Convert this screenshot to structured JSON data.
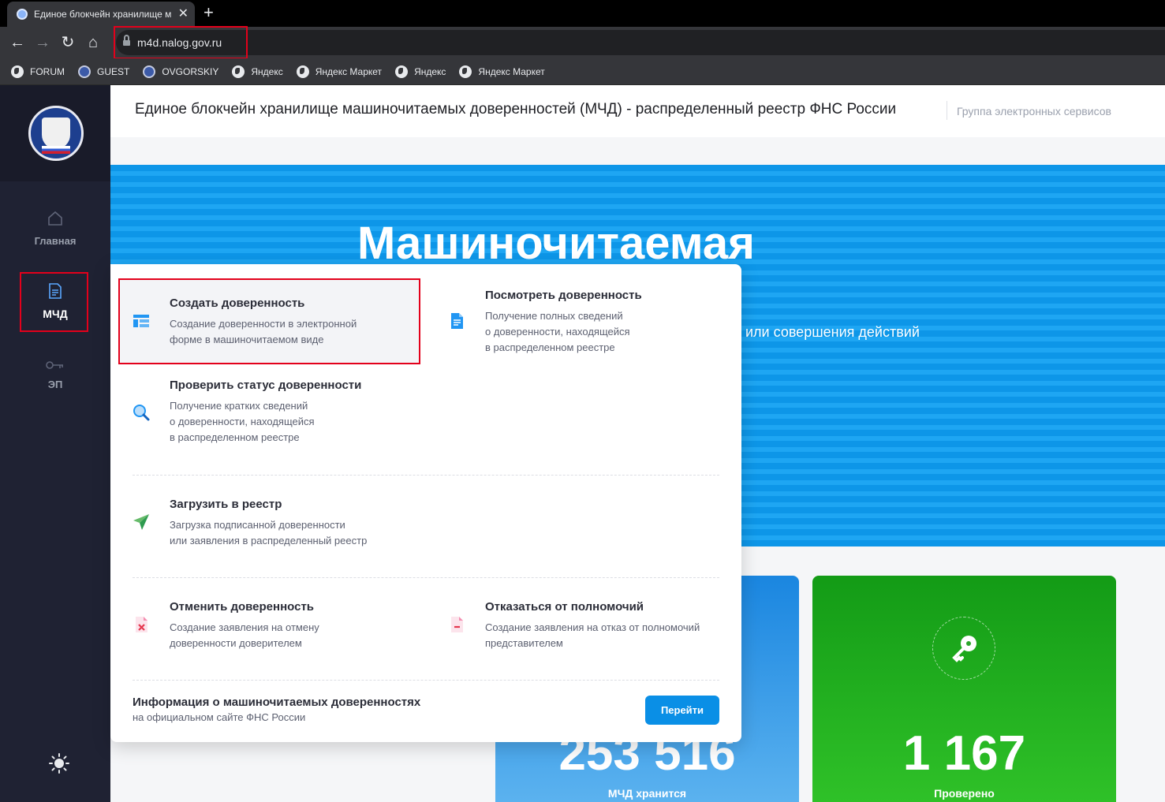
{
  "browser": {
    "tab_title": "Единое блокчейн хранилище м",
    "url": "m4d.nalog.gov.ru",
    "bookmarks": [
      "FORUM",
      "GUEST",
      "OVGORSKIY",
      "Яндекс",
      "Яндекс Маркет",
      "Яндекс",
      "Яндекс Маркет"
    ]
  },
  "sidebar": {
    "items": [
      {
        "label": "Главная"
      },
      {
        "label": "МЧД"
      },
      {
        "label": "ЭП"
      }
    ]
  },
  "header": {
    "title": "Единое блокчейн хранилище машиночитаемых доверенностей (МЧД) - распределенный реестр ФНС России",
    "group": "Группа электронных сервисов"
  },
  "hero": {
    "title": "Машиночитаемая",
    "subtitle_fragment": "или совершения действий"
  },
  "stats": {
    "stored_value": "253 516",
    "stored_label": "МЧД хранится",
    "checked_value": "1 167",
    "checked_label": "Проверено"
  },
  "menu": {
    "create": {
      "title": "Создать доверенность",
      "desc": [
        "Создание доверенности в электронной",
        "форме в машиночитаемом виде"
      ]
    },
    "view": {
      "title": "Посмотреть доверенность",
      "desc": [
        "Получение полных сведений",
        "о доверенности, находящейся",
        "в распределенном реестре"
      ]
    },
    "status": {
      "title": "Проверить статус доверенности",
      "desc": [
        "Получение кратких сведений",
        "о доверенности, находящейся",
        "в распределенном реестре"
      ]
    },
    "upload": {
      "title": "Загрузить в реестр",
      "desc": [
        "Загрузка подписанной доверенности",
        "или заявления в распределенный реестр"
      ]
    },
    "cancel": {
      "title": "Отменить доверенность",
      "desc": [
        "Создание заявления на отмену",
        "доверенности доверителем"
      ]
    },
    "refuse": {
      "title": "Отказаться от полномочий",
      "desc": [
        "Создание заявления на отказ от полномочий",
        "представителем"
      ]
    },
    "info_title": "Информация о машиночитаемых доверенностях",
    "info_sub": "на официальном сайте ФНС России",
    "go_button": "Перейти"
  },
  "colors": {
    "accent": "#0a8fe6",
    "highlight": "#e3001b",
    "sidebar": "#1f2233",
    "success": "#139b16"
  }
}
